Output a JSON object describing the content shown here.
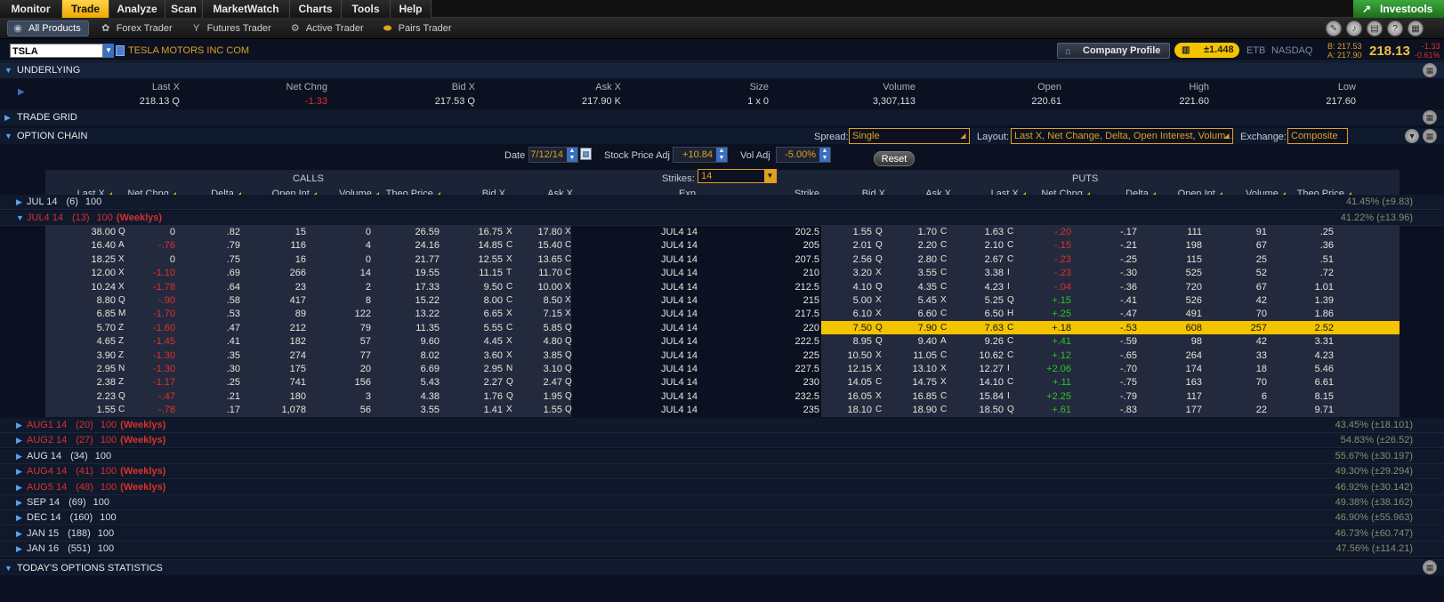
{
  "nav": {
    "tabs": [
      "Monitor",
      "Trade",
      "Analyze",
      "Scan",
      "MarketWatch",
      "Charts",
      "Tools",
      "Help"
    ],
    "active": "Trade",
    "brand": "Investools"
  },
  "subnav": {
    "items": [
      "All Products",
      "Forex Trader",
      "Futures Trader",
      "Active Trader",
      "Pairs Trader"
    ],
    "active": "All Products",
    "icons": [
      "globe-icon",
      "forex-icon",
      "futures-icon",
      "active-trader-icon",
      "pairs-icon"
    ]
  },
  "symbol": {
    "value": "TSLA",
    "company": "TESLA MOTORS INC COM",
    "company_profile": "Company Profile",
    "pill": "±1.448",
    "etb": "ETB",
    "exchange": "NASDAQ",
    "bid_line": "B: 217.53",
    "ask_line": "A: 217.90",
    "last": "218.13",
    "chg_line1": "-1.33",
    "chg_line2": "-0.61%"
  },
  "underlying": {
    "title": "UNDERLYING",
    "headers": [
      "Last X",
      "Net Chng",
      "Bid X",
      "Ask X",
      "Size",
      "Volume",
      "Open",
      "High",
      "Low"
    ],
    "values": [
      "218.13 Q",
      "-1.33",
      "217.53 Q",
      "217.90 K",
      "1 x 0",
      "3,307,113",
      "220.61",
      "221.60",
      "217.60"
    ]
  },
  "sections": {
    "trade_grid": "TRADE GRID",
    "option_chain": "OPTION CHAIN",
    "stats": "TODAY'S OPTIONS STATISTICS"
  },
  "controls": {
    "spread_label": "Spread:",
    "spread": "Single",
    "layout_label": "Layout:",
    "layout": "Last X, Net Change, Delta, Open Interest, Volum...",
    "exchange_label": "Exchange:",
    "exchange": "Composite",
    "date_label": "Date",
    "date": "7/12/14",
    "stock_adj_label": "Stock Price Adj",
    "stock_adj": "+10.84",
    "vol_adj_label": "Vol Adj",
    "vol_adj": "-5.00%",
    "reset": "Reset",
    "strikes_label": "Strikes:",
    "strikes": "14"
  },
  "grid": {
    "calls_caption": "CALLS",
    "puts_caption": "PUTS",
    "call_headers": [
      "Last X",
      "Net Chng",
      "Delta",
      "Open.Int",
      "Volume",
      "Theo Price",
      "Bid X",
      "Ask X"
    ],
    "mid_headers": [
      "Exp",
      "Strike"
    ],
    "put_headers": [
      "Bid X",
      "Ask X",
      "Last X",
      "Net Chng",
      "Delta",
      "Open.Int",
      "Volume",
      "Theo Price"
    ]
  },
  "expiries_top": [
    {
      "label": "JUL 14",
      "count": "(6)",
      "mult": "100",
      "weekly": "",
      "iv": "41.45% (±9.83)",
      "red": false,
      "open": false
    },
    {
      "label": "JUL4 14",
      "count": "(13)",
      "mult": "100",
      "weekly": "(Weeklys)",
      "iv": "41.22% (±13.96)",
      "red": true,
      "open": true
    }
  ],
  "rows": [
    {
      "c": [
        "38.00",
        "Q",
        "0",
        "",
        ".82",
        "15",
        "0",
        "26.59",
        "16.75",
        "X",
        "17.80",
        "X"
      ],
      "exp": "JUL4 14",
      "strike": "202.5",
      "p": [
        "1.55",
        "Q",
        "1.70",
        "C",
        "1.63",
        "C",
        "-.20",
        "-.17",
        "111",
        "91",
        ".25"
      ]
    },
    {
      "c": [
        "16.40",
        "A",
        "-.76",
        "neg",
        ".79",
        "116",
        "4",
        "24.16",
        "14.85",
        "C",
        "15.40",
        "C"
      ],
      "exp": "JUL4 14",
      "strike": "205",
      "p": [
        "2.01",
        "Q",
        "2.20",
        "C",
        "2.10",
        "C",
        "-.15",
        "-.21",
        "198",
        "67",
        ".36"
      ]
    },
    {
      "c": [
        "18.25",
        "X",
        "0",
        "",
        ".75",
        "16",
        "0",
        "21.77",
        "12.55",
        "X",
        "13.65",
        "C"
      ],
      "exp": "JUL4 14",
      "strike": "207.5",
      "p": [
        "2.56",
        "Q",
        "2.80",
        "C",
        "2.67",
        "C",
        "-.23",
        "-.25",
        "115",
        "25",
        ".51"
      ]
    },
    {
      "c": [
        "12.00",
        "X",
        "-1.10",
        "neg",
        ".69",
        "266",
        "14",
        "19.55",
        "11.15",
        "T",
        "11.70",
        "C"
      ],
      "exp": "JUL4 14",
      "strike": "210",
      "p": [
        "3.20",
        "X",
        "3.55",
        "C",
        "3.38",
        "I",
        "-.23",
        "-.30",
        "525",
        "52",
        ".72"
      ]
    },
    {
      "c": [
        "10.24",
        "X",
        "-1.78",
        "neg",
        ".64",
        "23",
        "2",
        "17.33",
        "9.50",
        "C",
        "10.00",
        "X"
      ],
      "exp": "JUL4 14",
      "strike": "212.5",
      "p": [
        "4.10",
        "Q",
        "4.35",
        "C",
        "4.23",
        "I",
        "-.04",
        "-.36",
        "720",
        "67",
        "1.01"
      ]
    },
    {
      "c": [
        "8.80",
        "Q",
        "-.90",
        "neg",
        ".58",
        "417",
        "8",
        "15.22",
        "8.00",
        "C",
        "8.50",
        "X"
      ],
      "exp": "JUL4 14",
      "strike": "215",
      "p": [
        "5.00",
        "X",
        "5.45",
        "X",
        "5.25",
        "Q",
        "+.15",
        "-.41",
        "526",
        "42",
        "1.39"
      ]
    },
    {
      "c": [
        "6.85",
        "M",
        "-1.70",
        "neg",
        ".53",
        "89",
        "122",
        "13.22",
        "6.65",
        "X",
        "7.15",
        "X"
      ],
      "exp": "JUL4 14",
      "strike": "217.5",
      "p": [
        "6.10",
        "X",
        "6.60",
        "C",
        "6.50",
        "H",
        "+.25",
        "-.47",
        "491",
        "70",
        "1.86"
      ]
    },
    {
      "c": [
        "5.70",
        "Z",
        "-1.60",
        "neg",
        ".47",
        "212",
        "79",
        "11.35",
        "5.55",
        "C",
        "5.85",
        "Q"
      ],
      "exp": "JUL4 14",
      "strike": "220",
      "p": [
        "7.50",
        "Q",
        "7.90",
        "C",
        "7.63",
        "C",
        "+.18",
        "-.53",
        "608",
        "257",
        "2.52"
      ],
      "hl": true
    },
    {
      "c": [
        "4.65",
        "Z",
        "-1.45",
        "neg",
        ".41",
        "182",
        "57",
        "9.60",
        "4.45",
        "X",
        "4.80",
        "Q"
      ],
      "exp": "JUL4 14",
      "strike": "222.5",
      "p": [
        "8.95",
        "Q",
        "9.40",
        "A",
        "9.26",
        "C",
        "+.41",
        "-.59",
        "98",
        "42",
        "3.31"
      ]
    },
    {
      "c": [
        "3.90",
        "Z",
        "-1.30",
        "neg",
        ".35",
        "274",
        "77",
        "8.02",
        "3.60",
        "X",
        "3.85",
        "Q"
      ],
      "exp": "JUL4 14",
      "strike": "225",
      "p": [
        "10.50",
        "X",
        "11.05",
        "C",
        "10.62",
        "C",
        "+.12",
        "-.65",
        "264",
        "33",
        "4.23"
      ]
    },
    {
      "c": [
        "2.95",
        "N",
        "-1.30",
        "neg",
        ".30",
        "175",
        "20",
        "6.69",
        "2.95",
        "N",
        "3.10",
        "Q"
      ],
      "exp": "JUL4 14",
      "strike": "227.5",
      "p": [
        "12.15",
        "X",
        "13.10",
        "X",
        "12.27",
        "I",
        "+2.06",
        "-.70",
        "174",
        "18",
        "5.46"
      ]
    },
    {
      "c": [
        "2.38",
        "Z",
        "-1.17",
        "neg",
        ".25",
        "741",
        "156",
        "5.43",
        "2.27",
        "Q",
        "2.47",
        "Q"
      ],
      "exp": "JUL4 14",
      "strike": "230",
      "p": [
        "14.05",
        "C",
        "14.75",
        "X",
        "14.10",
        "C",
        "+.11",
        "-.75",
        "163",
        "70",
        "6.61"
      ]
    },
    {
      "c": [
        "2.23",
        "Q",
        "-.47",
        "neg",
        ".21",
        "180",
        "3",
        "4.38",
        "1.76",
        "Q",
        "1.95",
        "Q"
      ],
      "exp": "JUL4 14",
      "strike": "232.5",
      "p": [
        "16.05",
        "X",
        "16.85",
        "C",
        "15.84",
        "I",
        "+2.25",
        "-.79",
        "117",
        "6",
        "8.15"
      ]
    },
    {
      "c": [
        "1.55",
        "C",
        "-.78",
        "neg",
        ".17",
        "1,078",
        "56",
        "3.55",
        "1.41",
        "X",
        "1.55",
        "Q"
      ],
      "exp": "JUL4 14",
      "strike": "235",
      "p": [
        "18.10",
        "C",
        "18.90",
        "C",
        "18.50",
        "Q",
        "+.61",
        "-.83",
        "177",
        "22",
        "9.71"
      ]
    }
  ],
  "expiries_bottom": [
    {
      "label": "AUG1 14",
      "count": "(20)",
      "mult": "100",
      "weekly": "(Weeklys)",
      "iv": "43.45% (±18.101)",
      "red": true
    },
    {
      "label": "AUG2 14",
      "count": "(27)",
      "mult": "100",
      "weekly": "(Weeklys)",
      "iv": "54.83% (±26.52)",
      "red": true
    },
    {
      "label": "AUG 14",
      "count": "(34)",
      "mult": "100",
      "weekly": "",
      "iv": "55.67% (±30.197)",
      "red": false
    },
    {
      "label": "AUG4 14",
      "count": "(41)",
      "mult": "100",
      "weekly": "(Weeklys)",
      "iv": "49.30% (±29.294)",
      "red": true
    },
    {
      "label": "AUG5 14",
      "count": "(48)",
      "mult": "100",
      "weekly": "(Weeklys)",
      "iv": "46.92% (±30.142)",
      "red": true
    },
    {
      "label": "SEP 14",
      "count": "(69)",
      "mult": "100",
      "weekly": "",
      "iv": "49.38% (±38.162)",
      "red": false
    },
    {
      "label": "DEC 14",
      "count": "(160)",
      "mult": "100",
      "weekly": "",
      "iv": "46.90% (±55.963)",
      "red": false
    },
    {
      "label": "JAN 15",
      "count": "(188)",
      "mult": "100",
      "weekly": "",
      "iv": "46.73% (±60.747)",
      "red": false
    },
    {
      "label": "JAN 16",
      "count": "(551)",
      "mult": "100",
      "weekly": "",
      "iv": "47.56% (±114.21)",
      "red": false
    }
  ]
}
